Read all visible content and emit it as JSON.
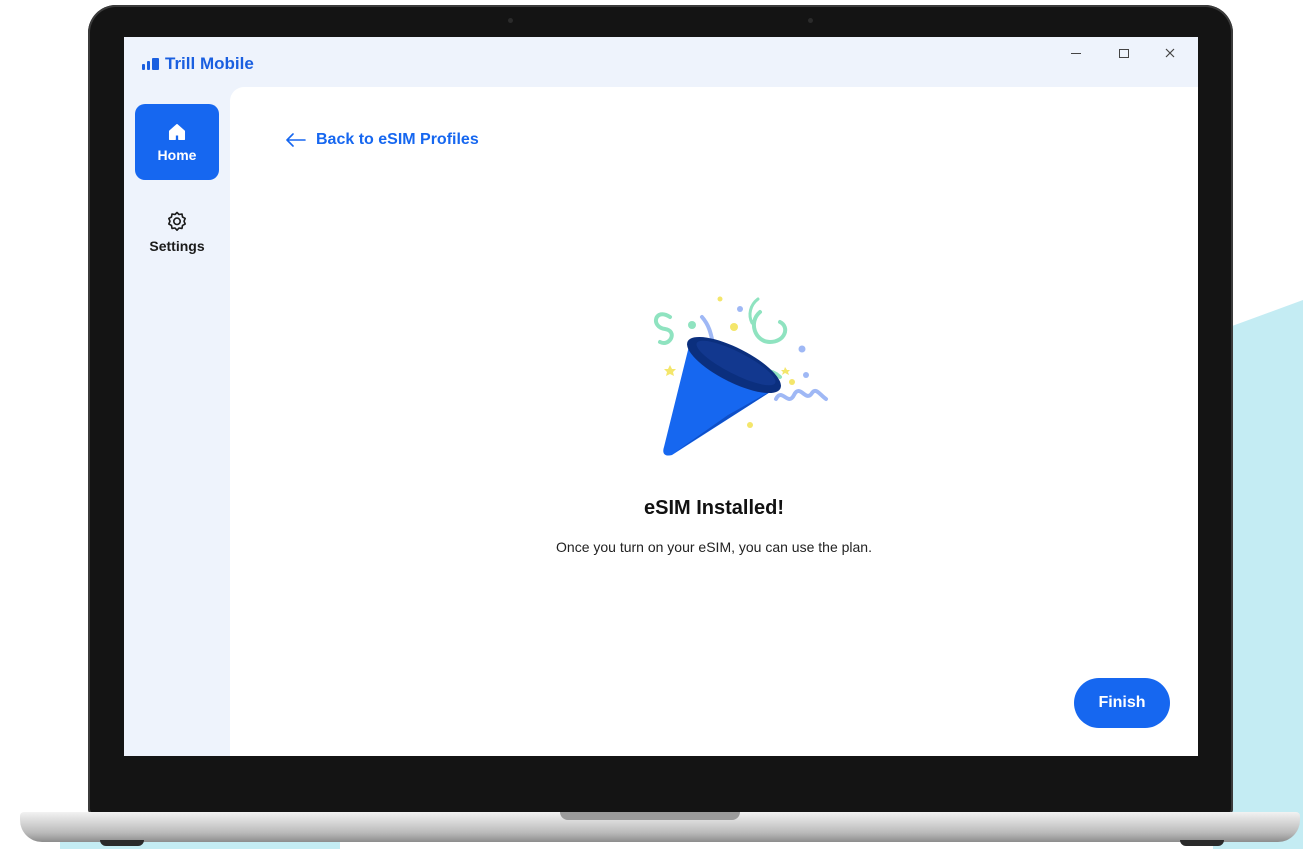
{
  "app": {
    "title": "Trill Mobile"
  },
  "window_controls": {
    "minimize_icon": "minimize-icon",
    "maximize_icon": "maximize-icon",
    "close_icon": "close-icon"
  },
  "sidebar": {
    "items": [
      {
        "label": "Home",
        "icon": "home-icon",
        "active": true
      },
      {
        "label": "Settings",
        "icon": "gear-icon",
        "active": false
      }
    ]
  },
  "main": {
    "back_link": "Back to eSIM Profiles",
    "illustration": "party-popper-icon",
    "title": "eSIM Installed!",
    "message": "Once you turn on your eSIM, you can use the plan.",
    "finish_label": "Finish"
  },
  "colors": {
    "accent": "#1667f0",
    "sidebar_bg": "#eef3fc",
    "background_accent": "#c4ecf3"
  }
}
